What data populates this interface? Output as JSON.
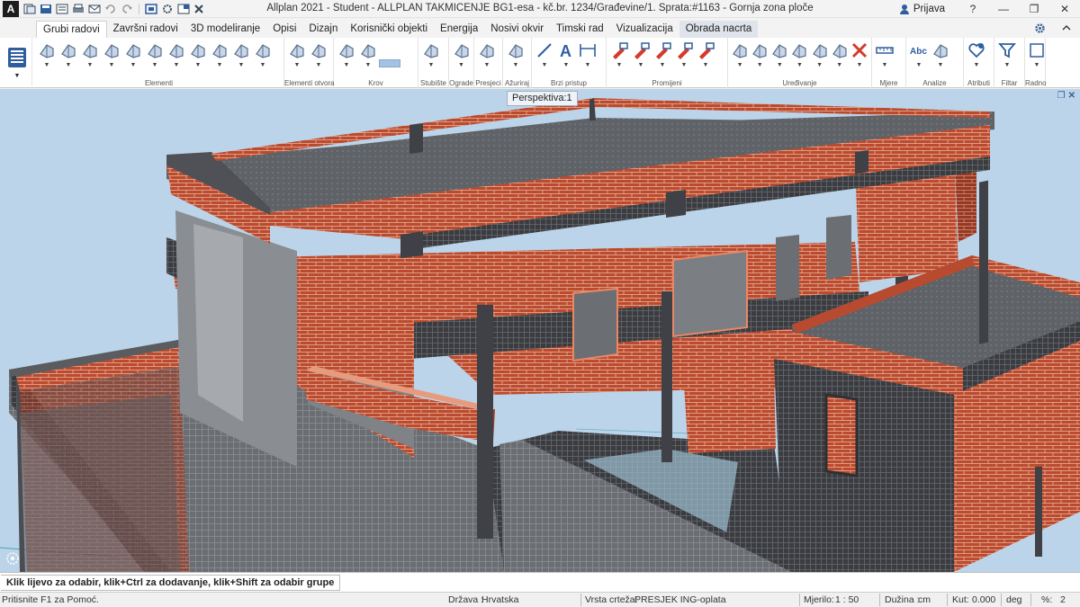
{
  "app": {
    "logo_letter": "A",
    "title": "Allplan 2021 - Student - ALLPLAN TAKMICENJE BG1-esa - kč.br. 1234/Građevine/1. Sprata:#1163 - Gornja zona ploče",
    "signin_label": "Prijava"
  },
  "quick_access": [
    "new-file-icon",
    "save-icon",
    "open-icon",
    "print-icon",
    "email-icon",
    "undo-icon",
    "redo-icon",
    "copy-icon",
    "settings-icon",
    "windows-icon",
    "tools-icon"
  ],
  "tabs": [
    {
      "label": "Grubi radovi",
      "active": true
    },
    {
      "label": "Završni radovi"
    },
    {
      "label": "3D modeliranje"
    },
    {
      "label": "Opisi"
    },
    {
      "label": "Dizajn"
    },
    {
      "label": "Korisnički objekti"
    },
    {
      "label": "Energija"
    },
    {
      "label": "Nosivi okvir"
    },
    {
      "label": "Timski rad"
    },
    {
      "label": "Vizualizacija"
    },
    {
      "label": "Obrada nacrta",
      "highlight": true
    }
  ],
  "ribbon_groups": [
    {
      "label": "Elementi"
    },
    {
      "label": "Elementi otvora"
    },
    {
      "label": "Krov"
    },
    {
      "label": "Stubište"
    },
    {
      "label": "Ograde"
    },
    {
      "label": "Presjeci"
    },
    {
      "label": "Ažuriraj"
    },
    {
      "label": "Brzi pristup"
    },
    {
      "label": "Promijeni"
    },
    {
      "label": "Uređivanje"
    },
    {
      "label": "Mjere"
    },
    {
      "label": "Analize"
    },
    {
      "label": "Atributi"
    },
    {
      "label": "Filtar"
    },
    {
      "label": "Radno"
    }
  ],
  "annotation_text": "Abc",
  "viewport": {
    "label": "Perspektiva:1",
    "colors": {
      "sky": "#bcd4e9",
      "brick": "#b84a30",
      "mortar": "#e8b6a0",
      "concrete": "#5a5d62",
      "slab": "#6b6e73"
    }
  },
  "prompt": "Klik lijevo za odabir, klik+Ctrl za dodavanje, klik+Shift za odabir grupe",
  "status": {
    "help": "Pritisnite F1 za Pomoć.",
    "country_label": "Država :",
    "country_value": "Hrvatska",
    "drawing_type_label": "Vrsta crteža:",
    "drawing_type_value": "PRESJEK ING-oplata",
    "scale_label": "Mjerilo:",
    "scale_value": "1 : 50",
    "length_label": "Dužina :",
    "length_value": "cm",
    "angle_label": "Kut:",
    "angle_value": "0.000",
    "angle_unit": "deg",
    "percent_label": "%:",
    "percent_value": "2"
  }
}
